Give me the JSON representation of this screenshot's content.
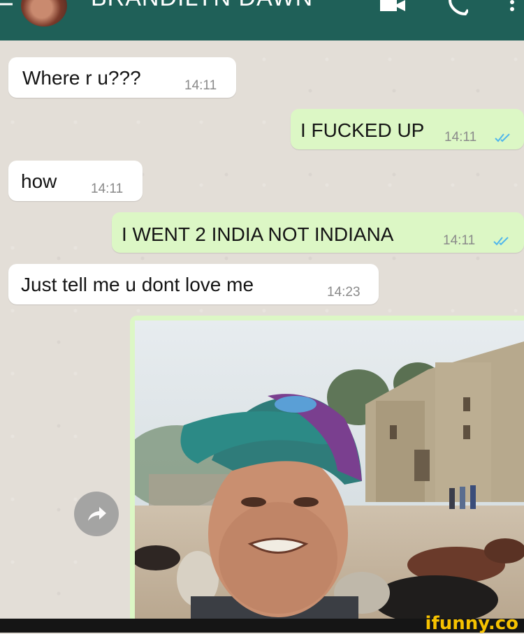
{
  "header": {
    "contact_name": "BRANDILYN DAWN",
    "background": "#1f6058"
  },
  "messages": [
    {
      "direction": "incoming",
      "text": "Where r u???",
      "time": "14:11"
    },
    {
      "direction": "outgoing",
      "text": "I FUCKED UP",
      "time": "14:11",
      "status": "read"
    },
    {
      "direction": "incoming",
      "text": "how",
      "time": "14:11"
    },
    {
      "direction": "outgoing",
      "text": "I WENT 2 INDIA NOT INDIANA",
      "time": "14:11",
      "status": "read"
    },
    {
      "direction": "incoming",
      "text": "Just tell me u dont love me",
      "time": "14:23"
    }
  ],
  "photo_message": {
    "direction": "outgoing",
    "content": "selfie-photo"
  },
  "colors": {
    "incoming_bubble": "#ffffff",
    "outgoing_bubble": "#dcf7c5",
    "read_ticks": "#4fb6ec",
    "chat_background": "#e3ded7"
  },
  "icons": [
    "back-arrow-icon",
    "video-call-icon",
    "phone-call-icon",
    "more-options-icon",
    "forward-icon"
  ],
  "watermark": "ifunny.co"
}
